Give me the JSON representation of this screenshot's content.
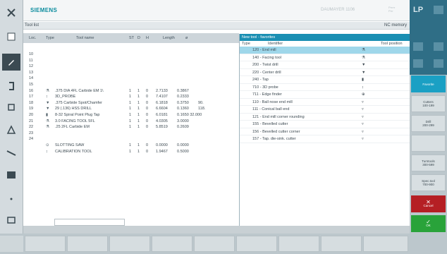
{
  "header": {
    "brand": "SIEMENS",
    "status": "DAUMAYER 1106",
    "status_mini": [
      "Prrrrr",
      "Prrr"
    ]
  },
  "subheader": {
    "left": "Tool list",
    "right": "NC memory"
  },
  "table": {
    "columns": [
      "Loc.",
      "Type",
      "Tool name",
      "ST",
      "D",
      "H",
      "Length",
      "ø"
    ],
    "rows": [
      {
        "loc": "10",
        "type": "",
        "name": "",
        "st": "",
        "d": "",
        "h": "",
        "len": "",
        "rad": "",
        "x1": ""
      },
      {
        "loc": "11",
        "type": "",
        "name": "",
        "st": "",
        "d": "",
        "h": "",
        "len": "",
        "rad": "",
        "x1": ""
      },
      {
        "loc": "12",
        "type": "",
        "name": "",
        "st": "",
        "d": "",
        "h": "",
        "len": "",
        "rad": "",
        "x1": ""
      },
      {
        "loc": "13",
        "type": "",
        "name": "",
        "st": "",
        "d": "",
        "h": "",
        "len": "",
        "rad": "",
        "x1": ""
      },
      {
        "loc": "14",
        "type": "",
        "name": "",
        "st": "",
        "d": "",
        "h": "",
        "len": "",
        "rad": "",
        "x1": ""
      },
      {
        "loc": "15",
        "type": "",
        "name": "",
        "st": "",
        "d": "",
        "h": "",
        "len": "",
        "rad": "",
        "x1": ""
      },
      {
        "loc": "16",
        "type": "⚗",
        "name": ".375 DIA 4FL Carbide EM 1\\",
        "st": "1",
        "d": "1",
        "h": "0",
        "len": "2.7133",
        "rad": "0.3867",
        "x1": ""
      },
      {
        "loc": "17",
        "type": "↕",
        "name": "3D_PROBE",
        "st": "1",
        "d": "1",
        "h": "0",
        "len": "7.4107",
        "rad": "0.2333",
        "x1": ""
      },
      {
        "loc": "18",
        "type": "▼",
        "name": ".375 Carbide Spot/Chamfer",
        "st": "1",
        "d": "1",
        "h": "0",
        "len": "6.1818",
        "rad": "0.3750",
        "x1": "90."
      },
      {
        "loc": "19",
        "type": "▼",
        "name": "29 (.136) HSS DRILL",
        "st": "1",
        "d": "1",
        "h": "0",
        "len": "6.6604",
        "rad": "0.1360",
        "x1": "118."
      },
      {
        "loc": "20",
        "type": "▮",
        "name": "8-32 Spiral Point Plug Tap",
        "st": "1",
        "d": "1",
        "h": "0",
        "len": "6.0181",
        "rad": "0.1650 32.000",
        "x1": ""
      },
      {
        "loc": "21",
        "type": "⚗",
        "name": "3.0 FACING TOOL 5FL",
        "st": "1",
        "d": "1",
        "h": "0",
        "len": "4.0305",
        "rad": "3.0000",
        "x1": ""
      },
      {
        "loc": "22",
        "type": "⚗",
        "name": ".25 2FL Carbide EM",
        "st": "1",
        "d": "1",
        "h": "0",
        "len": "5.8519",
        "rad": "0.2609",
        "x1": ""
      },
      {
        "loc": "23",
        "type": "",
        "name": "",
        "st": "",
        "d": "",
        "h": "",
        "len": "",
        "rad": "",
        "x1": ""
      },
      {
        "loc": "24",
        "type": "",
        "name": "",
        "st": "",
        "d": "",
        "h": "",
        "len": "",
        "rad": "",
        "x1": ""
      },
      {
        "loc": "",
        "type": "⊙",
        "name": "SLOTTING SAW",
        "st": "1",
        "d": "1",
        "h": "0",
        "len": "0.0000",
        "rad": "0.0000",
        "x1": ""
      },
      {
        "loc": "",
        "type": "↕",
        "name": "CALIBRATION TOOL",
        "st": "1",
        "d": "1",
        "h": "0",
        "len": "1.9467",
        "rad": "0.5000",
        "x1": ""
      }
    ]
  },
  "popup": {
    "title": "New tool - favorites",
    "headers": [
      "Type",
      "Identifier",
      "Tool position"
    ],
    "items": [
      {
        "code": "120 - End mill",
        "icon": "⚗",
        "selected": true
      },
      {
        "code": "140 - Facing tool",
        "icon": "⚗",
        "selected": false
      },
      {
        "code": "200 - Twist drill",
        "icon": "▼",
        "selected": false
      },
      {
        "code": "220 - Center drill",
        "icon": "▼",
        "selected": false
      },
      {
        "code": "240 - Tap",
        "icon": "▮",
        "selected": false
      },
      {
        "code": "710 - 3D probe",
        "icon": "↕",
        "selected": false
      },
      {
        "code": "711 - Edge finder",
        "icon": "⊕",
        "selected": false
      },
      {
        "code": "110 - Ball nose end mill",
        "icon": "▿",
        "selected": false
      },
      {
        "code": "111 - Conical ball end",
        "icon": "▿",
        "selected": false
      },
      {
        "code": "121 - End mill corner rounding",
        "icon": "▿",
        "selected": false
      },
      {
        "code": "155 - Bevelled cutter",
        "icon": "▿",
        "selected": false
      },
      {
        "code": "156 - Bevelled cutter corner",
        "icon": "▿",
        "selected": false
      },
      {
        "code": "157 - Tap. die-sink. cutter",
        "icon": "▿",
        "selected": false
      }
    ]
  },
  "softkeys": {
    "top_label": "LP",
    "favorite": "Favorite",
    "cutters": "Cutters\n100-199",
    "drill": "Drill\n200-299",
    "turnkeys": "Turntools\n300-599",
    "spec": "Spec.tool\n700-900",
    "cancel": "Cancel",
    "ok": "OK"
  },
  "colors": {
    "brand": "#0b8c9e",
    "selection": "#9fd7ea",
    "popup_title": "#1a8fb3",
    "cancel": "#b51f24",
    "ok": "#29a33a",
    "active": "#1aa0c4"
  }
}
